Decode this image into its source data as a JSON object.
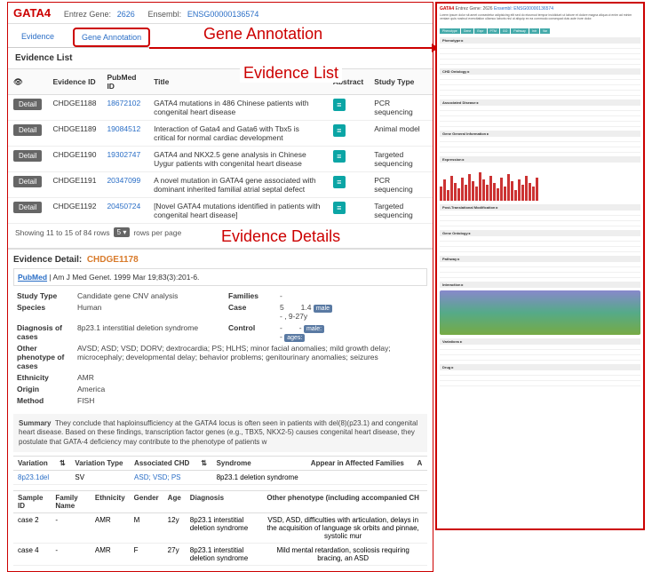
{
  "header": {
    "gene": "GATA4",
    "entrez_label": "Entrez Gene:",
    "entrez": "2626",
    "ensembl_label": "Ensembl:",
    "ensembl": "ENSG00000136574"
  },
  "tabs": {
    "evidence": "Evidence",
    "annotation": "Gene  Annotation"
  },
  "big_labels": {
    "ga": "Gene Annotation",
    "el": "Evidence List",
    "ed": "Evidence Details"
  },
  "evidence_list": {
    "title": "Evidence List",
    "cols": {
      "eye": "👁",
      "eid": "Evidence ID",
      "pmid": "PubMed ID",
      "title": "Title",
      "abs": "Abstract",
      "study": "Study Type"
    },
    "detail_btn": "Detail",
    "rows": [
      {
        "eid": "CHDGE1188",
        "pmid": "18672102",
        "title": "GATA4 mutations in 486 Chinese patients with congenital heart disease",
        "study": "PCR sequencing"
      },
      {
        "eid": "CHDGE1189",
        "pmid": "19084512",
        "title": "Interaction of Gata4 and Gata6 with Tbx5 is critical for normal cardiac development",
        "study": "Animal model"
      },
      {
        "eid": "CHDGE1190",
        "pmid": "19302747",
        "title": "GATA4 and NKX2.5 gene analysis in Chinese Uygur patients with congenital heart disease",
        "study": "Targeted sequencing"
      },
      {
        "eid": "CHDGE1191",
        "pmid": "20347099",
        "title": "A novel mutation in GATA4 gene associated with dominant inherited familial atrial septal defect",
        "study": "PCR sequencing"
      },
      {
        "eid": "CHDGE1192",
        "pmid": "20450724",
        "title": "[Novel GATA4 mutations identified in patients with congenital heart disease]",
        "study": "Targeted sequencing"
      }
    ],
    "pager": {
      "showing": "Showing 11 to 15 of 84 rows",
      "per": "5",
      "suffix": "rows per page"
    }
  },
  "detail": {
    "title": "Evidence Detail:",
    "id": "CHDGE1178",
    "ref_link": "PubMed",
    "ref": " | Am J Med Genet. 1999 Mar 19;83(3):201-6.",
    "fields": {
      "study_type_k": "Study Type",
      "study_type_v": "Candidate gene CNV analysis",
      "species_k": "Species",
      "species_v": "Human",
      "diag_k": "Diagnosis of cases",
      "diag_v": "8p23.1 interstitial deletion syndrome",
      "other_k": "Other phenotype of cases",
      "other_v": "AVSD; ASD; VSD; DORV; dextrocardia; PS; HLHS; minor facial anomalies; mild growth delay; microcephaly; developmental delay; behavior problems; genitourinary anomalies; seizures",
      "eth_k": "Ethnicity",
      "eth_v": "AMR",
      "origin_k": "Origin",
      "origin_v": "America",
      "method_k": "Method",
      "method_v": "FISH",
      "fam_k": "Families",
      "fam_v": "-",
      "case_k": "Case",
      "case_v": "5",
      "case_extra1": "1.4",
      "case_badge1": "male",
      "case_extra2": "- , 9-27y",
      "ctrl_k": "Control",
      "ctrl_v": "-",
      "ctrl_badge1": "male:",
      "ctrl_badge2": "ages:"
    },
    "summary_k": "Summary",
    "summary_v": "They conclude that haploinsufficiency at the GATA4 locus is often seen in patients with del(8)(p23.1) and congenital heart disease. Based on these findings, transcription factor genes (e.g., TBX5, NKX2-5) causes congenital heart disease, they postulate that GATA-4 deficiency may contribute to the phenotype of patients w",
    "var_cols": {
      "var": "Variation",
      "vtype": "Variation Type",
      "achd": "Associated CHD",
      "syn": "Syndrome",
      "appear": "Appear in Affected Families",
      "a": "A"
    },
    "var_row": {
      "var": "8p23.1del",
      "vtype": "SV",
      "achd": "ASD; VSD; PS",
      "syn": "8p23.1 deletion syndrome"
    },
    "samp_cols": {
      "sid": "Sample ID",
      "fam": "Family Name",
      "eth": "Ethnicity",
      "gen": "Gender",
      "age": "Age",
      "diag": "Diagnosis",
      "other": "Other phenotype (including accompanied CH"
    },
    "samp_rows": [
      {
        "sid": "case 2",
        "fam": "-",
        "eth": "AMR",
        "gen": "M",
        "age": "12y",
        "diag": "8p23.1 interstitial deletion syndrome",
        "other": "VSD, ASD, difficulties with articulation, delays in the acquisition of language sk orbits and pinnae, systolic mur"
      },
      {
        "sid": "case 4",
        "fam": "-",
        "eth": "AMR",
        "gen": "F",
        "age": "27y",
        "diag": "8p23.1 interstitial deletion syndrome",
        "other": "Mild mental retardation, scoliosis requiring bracing, an ASD"
      }
    ]
  },
  "side": {
    "gene": "GATA4",
    "entrez": "Entrez Gene: 2626",
    "ensembl": "Ensembl: ENSG00000136574",
    "secs": [
      "Phenotype",
      "CHD Ontology",
      "Associated Disease",
      "Gene General Information",
      "Expression",
      "Post-Translational Modification",
      "Gene Ontology",
      "Pathway",
      "Interaction",
      "Variations",
      "Drug"
    ]
  }
}
